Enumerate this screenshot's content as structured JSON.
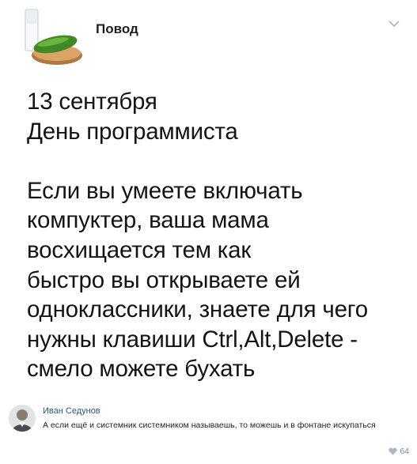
{
  "post": {
    "author": "Повод",
    "lines": [
      "13 сентября",
      "День программиста",
      "",
      "Если вы умеете включать",
      "компуктер, ваша мама",
      "восхищается тем как",
      "быстро вы открываете ей",
      "одноклассники, знаете для чего",
      "нужны клавиши Ctrl,Alt,Delete -",
      "смело можете бухать"
    ]
  },
  "comment": {
    "author": "Иван Седунов",
    "text": "А если ещё и системник системником называешь, то можешь и в фонтане искупаться",
    "likes": "64"
  },
  "colors": {
    "link": "#2a5885",
    "muted": "#7a8a99",
    "text": "#141414"
  },
  "icons": {
    "more": "chevron-down-icon",
    "like": "heart-icon"
  }
}
